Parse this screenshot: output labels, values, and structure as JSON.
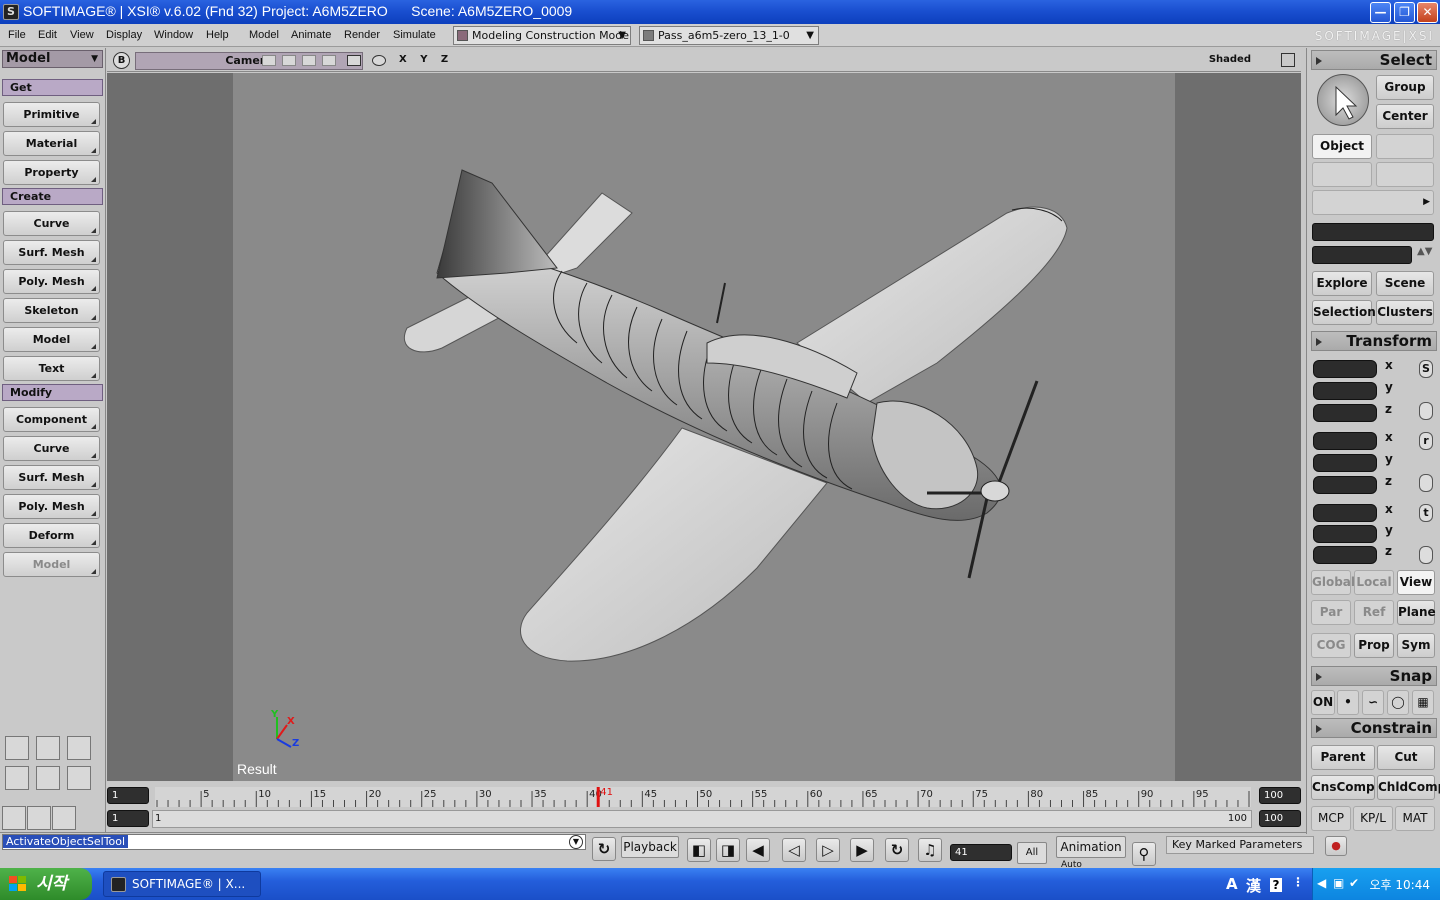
{
  "window": {
    "title": "SOFTIMAGE® | XSI® v.6.02 (Fnd 32) Project: A6M5ZERO      Scene: A6M5ZERO_0009",
    "app_icon": "softimage-logo-icon"
  },
  "menubar": {
    "items": [
      "File",
      "Edit",
      "View",
      "Display",
      "Window",
      "Help",
      "Model",
      "Animate",
      "Render",
      "Simulate"
    ],
    "mode_combo": "Modeling Construction Mode",
    "pass_combo": "Pass_a6m5-zero_13_1-0",
    "brand": "SOFTIMAGE|XSI"
  },
  "leftpanel": {
    "mode": "Model",
    "get_header": "Get",
    "get_buttons": [
      "Primitive",
      "Material",
      "Property"
    ],
    "create_header": "Create",
    "create_buttons": [
      "Curve",
      "Surf. Mesh",
      "Poly. Mesh",
      "Skeleton",
      "Model",
      "Text"
    ],
    "modify_header": "Modify",
    "modify_buttons": [
      "Component",
      "Curve",
      "Surf. Mesh",
      "Poly. Mesh",
      "Deform",
      "Model"
    ]
  },
  "viewport": {
    "view_button": "B",
    "camera": "Camera",
    "axes": "X Y Z",
    "display_mode": "Shaded",
    "result_label": "Result",
    "gizmo": {
      "x": "X",
      "y": "Y",
      "z": "Z"
    }
  },
  "timeline": {
    "start_field": "1",
    "ticks": [
      "5",
      "10",
      "15",
      "20",
      "25",
      "30",
      "35",
      "40",
      "45",
      "50",
      "55",
      "60",
      "65",
      "70",
      "75",
      "80",
      "85",
      "90",
      "95"
    ],
    "current_frame_marker": "41",
    "end_field": "100",
    "range_start_field": "1",
    "range_start_label": "1",
    "range_end_label": "100",
    "range_end_field": "100",
    "current_frame": 41,
    "frame_count": 100
  },
  "bottombar": {
    "command": "ActivateObjectSelTool",
    "playback_label": "Playback",
    "frame_field": "41",
    "all_label": "All",
    "animation_label": "Animation",
    "auto_label": "Auto",
    "key_marked_label": "Key Marked Parameters"
  },
  "rightpanel": {
    "select_header": "Select",
    "group_label": "Group",
    "center_label": "Center",
    "object_label": "Object",
    "explore_label": "Explore",
    "scene_label": "Scene",
    "selection_label": "Selection",
    "clusters_label": "Clusters",
    "transform_header": "Transform",
    "scale_icon": "S",
    "rotate_icon": "r",
    "translate_icon": "t",
    "axes": [
      "x",
      "y",
      "z"
    ],
    "ref_modes_row1": [
      "Global",
      "Local",
      "View"
    ],
    "ref_modes_row2": [
      "Par",
      "Ref",
      "Plane"
    ],
    "ref_modes_row3": [
      "COG",
      "Prop",
      "Sym"
    ],
    "snap_header": "Snap",
    "snap_on": "ON",
    "constrain_header": "Constrain",
    "constrain_buttons": [
      "Parent",
      "Cut",
      "CnsComp",
      "ChldComp"
    ],
    "bottom_tabs": [
      "MCP",
      "KP/L",
      "MAT"
    ]
  },
  "taskbar": {
    "start_label": "시작",
    "task_item": "SOFTIMAGE® | X...",
    "ime_a": "A",
    "ime_han": "漢",
    "clock": "오후 10:44"
  },
  "colors": {
    "viewport_bg": "#6e6e6e",
    "viewport_safe_area": "#8a8a8a",
    "section_header": "#b9a9c6",
    "timeline_marker": "#e01010",
    "titlebar_blue": "#1a4fd0"
  }
}
